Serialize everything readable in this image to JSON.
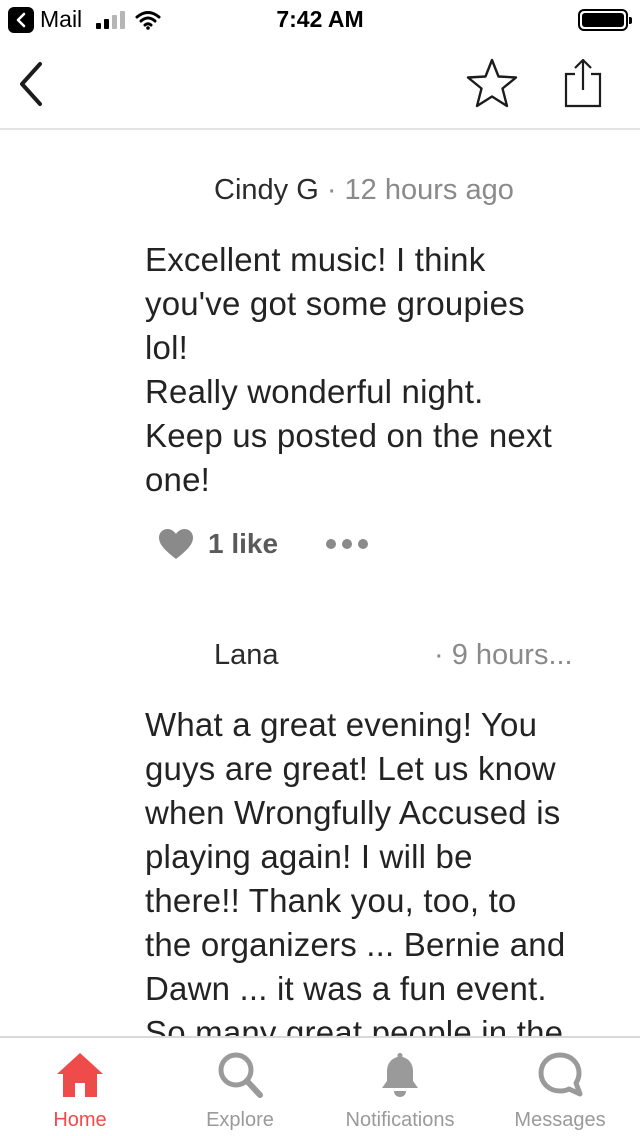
{
  "status_bar": {
    "app_label": "Mail",
    "time": "7:42 AM"
  },
  "nav": {
    "back_icon": "chevron-left-icon",
    "star_icon": "star-outline-icon",
    "share_icon": "share-icon"
  },
  "comments": [
    {
      "author": "Cindy G",
      "meta": " · 12 hours ago",
      "body": "Excellent music! I think\nyou've got some groupies\nlol!\nReally wonderful night.\nKeep us posted on the next\none!",
      "likes": "1 like"
    },
    {
      "author": "Lana",
      "meta": "· 9 hours...",
      "body": "What a great evening! You\nguys are great! Let us know\nwhen Wrongfully Accused is\nplaying again! I will be\nthere!! Thank you, too, to\nthe organizers ... Bernie and\nDawn ... it was a fun event.\nSo many great people in the"
    }
  ],
  "tabs": [
    {
      "label": "Home",
      "icon": "home-icon",
      "active": true
    },
    {
      "label": "Explore",
      "icon": "search-icon",
      "active": false
    },
    {
      "label": "Notifications",
      "icon": "bell-icon",
      "active": false
    },
    {
      "label": "Messages",
      "icon": "chat-bubble-icon",
      "active": false
    }
  ],
  "colors": {
    "accent": "#ef4b4b",
    "inactive": "#9a9a9a",
    "meta_text": "#8a8a8a"
  }
}
